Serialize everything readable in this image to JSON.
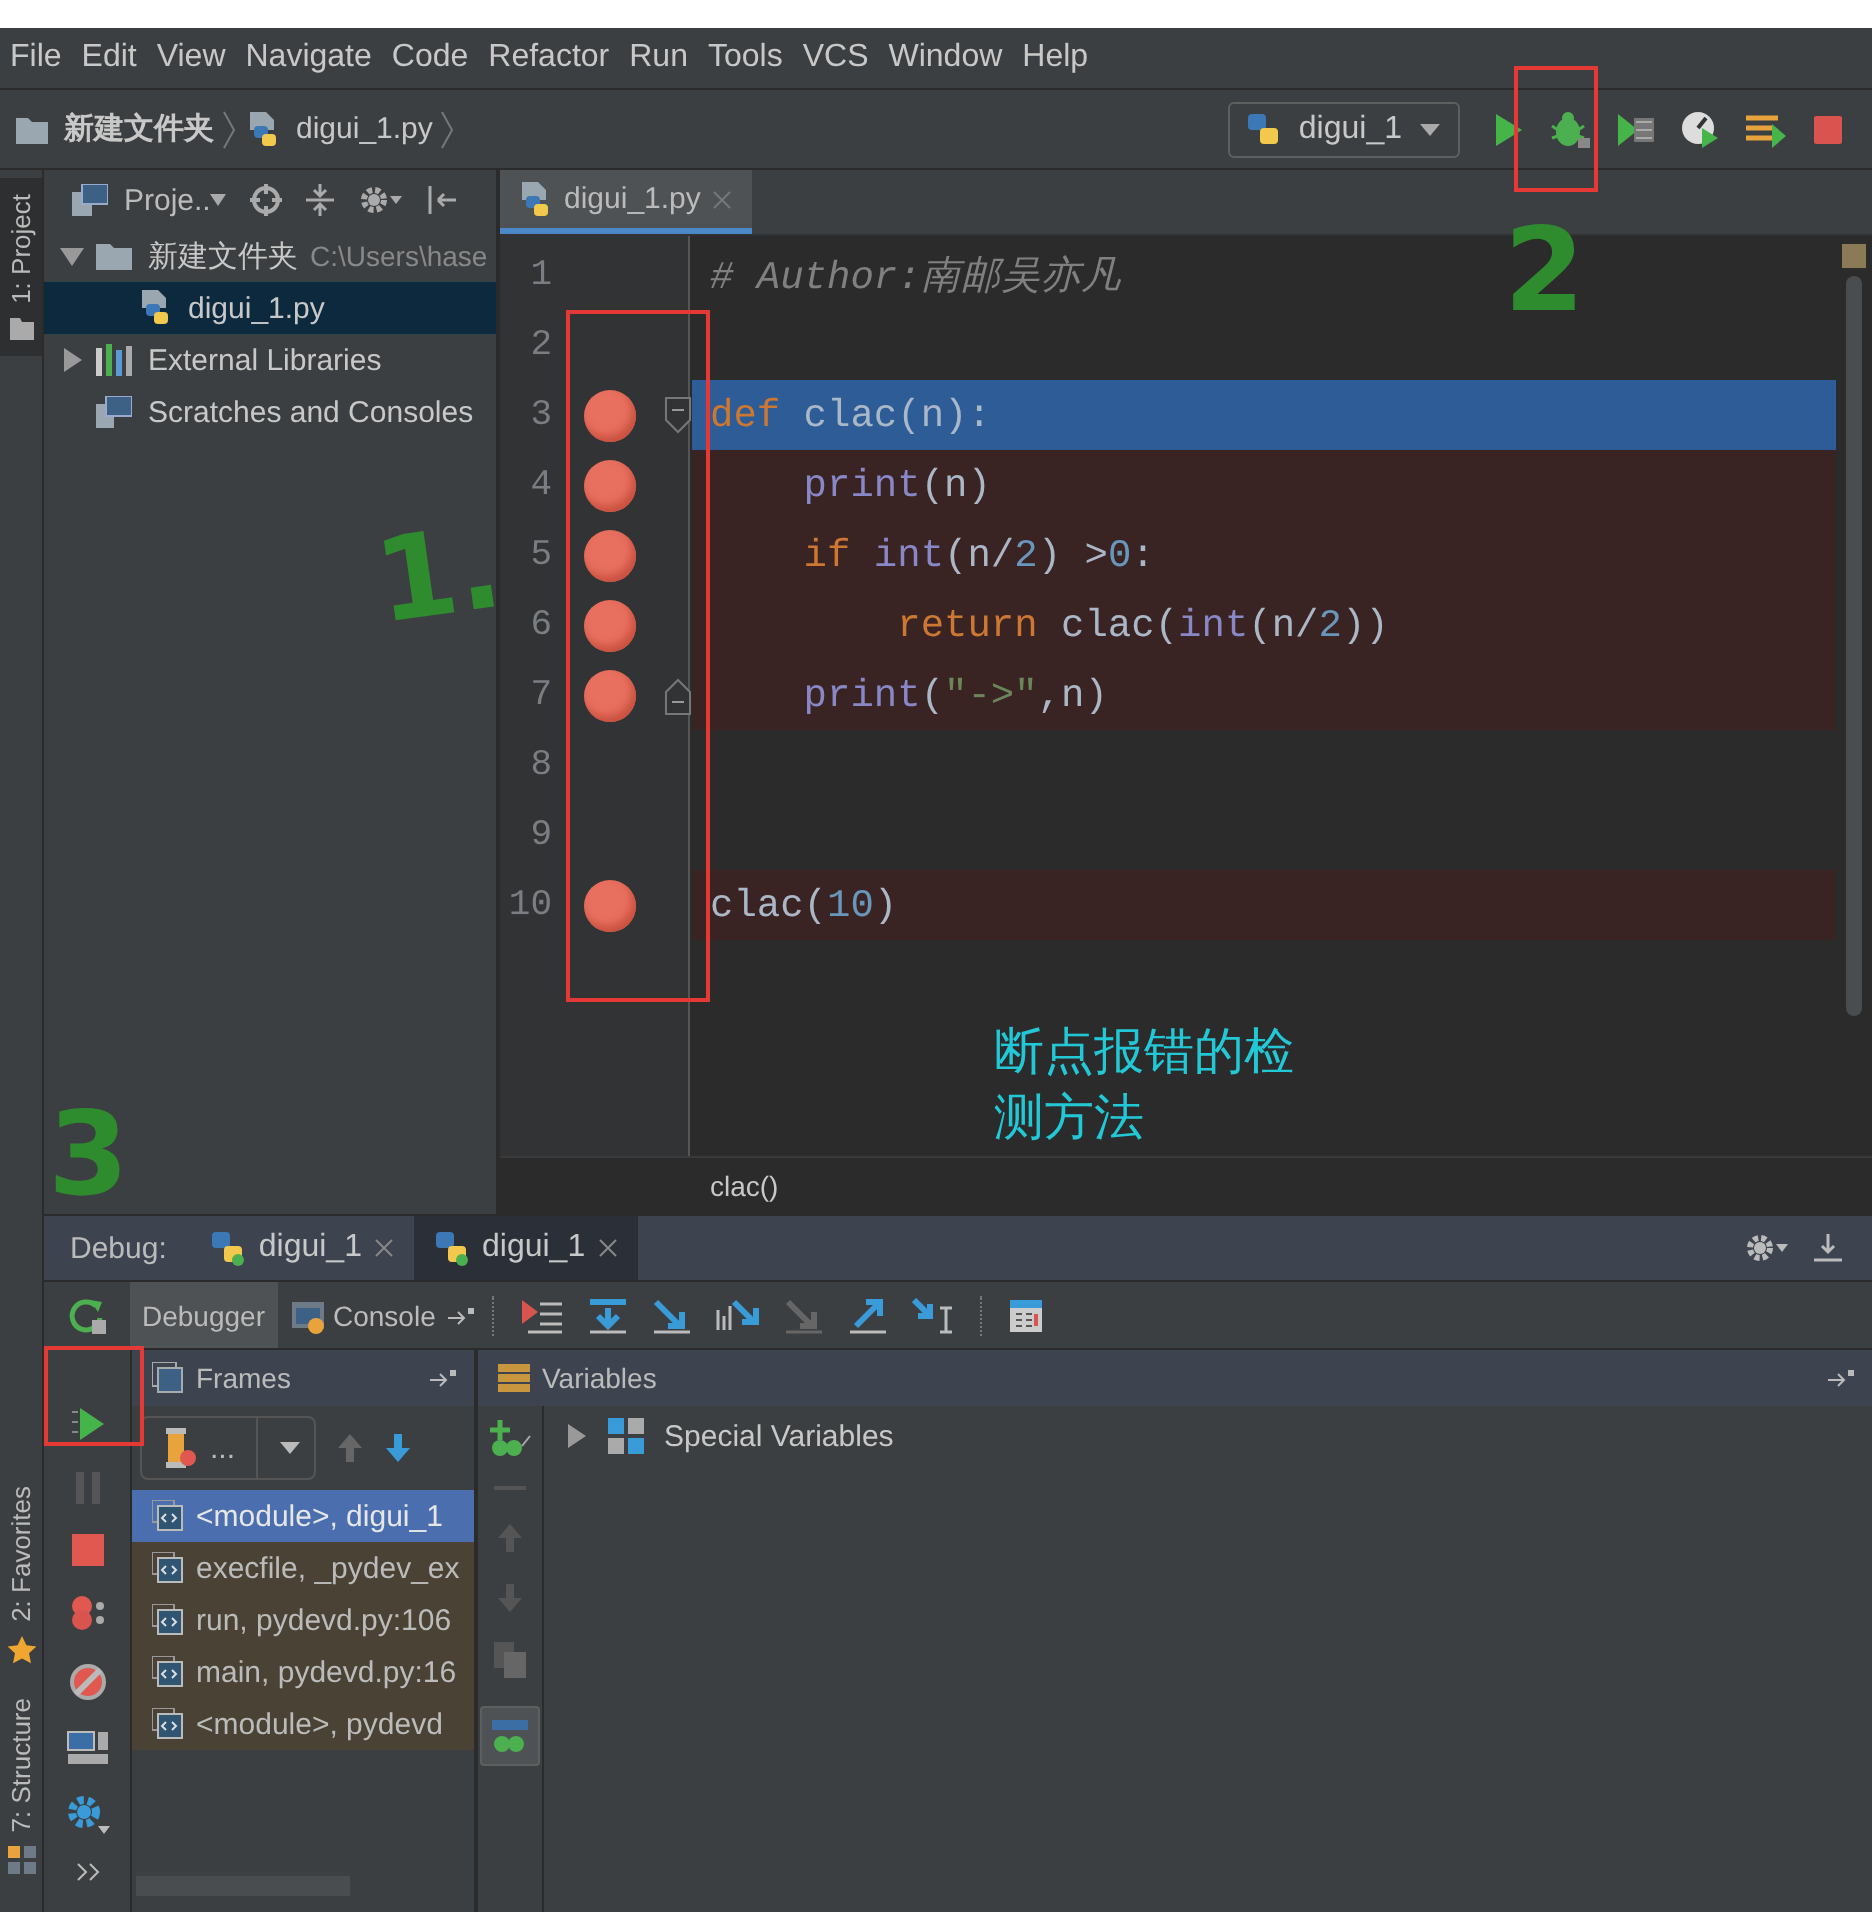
{
  "menu": [
    "File",
    "Edit",
    "View",
    "Navigate",
    "Code",
    "Refactor",
    "Run",
    "Tools",
    "VCS",
    "Window",
    "Help"
  ],
  "breadcrumb": [
    {
      "label": "新建文件夹",
      "kind": "folder"
    },
    {
      "label": "digui_1.py",
      "kind": "python"
    }
  ],
  "run_config": {
    "label": "digui_1"
  },
  "left_stripe": {
    "top": [
      {
        "label": "1: Project",
        "selected": true
      }
    ],
    "bottom": [
      {
        "label": "2: Favorites",
        "kind": "favorites",
        "selected": false
      },
      {
        "label": "7: Structure",
        "kind": "structure",
        "selected": false
      }
    ]
  },
  "project": {
    "title": "Proje..",
    "tree": [
      {
        "label": "新建文件夹",
        "path": "C:\\Users\\hase",
        "kind": "folder",
        "expanded": true,
        "selected": false,
        "children": [
          {
            "label": "digui_1.py",
            "kind": "python",
            "selected": true
          }
        ]
      },
      {
        "label": "External Libraries",
        "kind": "library",
        "expanded": false,
        "selected": false
      },
      {
        "label": "Scratches and Consoles",
        "kind": "scratch",
        "selected": false
      }
    ]
  },
  "editor": {
    "tabs": [
      {
        "label": "digui_1.py",
        "selected": true
      }
    ],
    "lines": [
      {
        "number": "1",
        "breakpoint": false,
        "current": false,
        "fold_start": false,
        "fold_end": false,
        "tokens": [
          {
            "kind": "comment",
            "text": "# Author:南邮吴亦凡"
          }
        ]
      },
      {
        "number": "2",
        "breakpoint": false,
        "current": false,
        "fold_start": false,
        "fold_end": false
      },
      {
        "number": "3",
        "breakpoint": true,
        "current": true,
        "fold_start": true,
        "fold_end": false,
        "tokens": [
          {
            "kind": "keyword",
            "text": "def"
          },
          {
            "kind": "plain",
            "text": " clac(n):"
          }
        ]
      },
      {
        "number": "4",
        "breakpoint": true,
        "current": false,
        "fold_start": false,
        "fold_end": false,
        "tokens": [
          {
            "kind": "builtin",
            "text": "    print"
          },
          {
            "kind": "plain",
            "text": "(n)"
          }
        ]
      },
      {
        "number": "5",
        "breakpoint": true,
        "current": false,
        "fold_start": false,
        "fold_end": false,
        "tokens": [
          {
            "kind": "keyword",
            "text": "    if "
          },
          {
            "kind": "builtin",
            "text": "int"
          },
          {
            "kind": "plain",
            "text": "(n/"
          },
          {
            "kind": "number",
            "text": "2"
          },
          {
            "kind": "plain",
            "text": ") >"
          },
          {
            "kind": "number",
            "text": "0"
          },
          {
            "kind": "plain",
            "text": ":"
          }
        ]
      },
      {
        "number": "6",
        "breakpoint": true,
        "current": false,
        "fold_start": false,
        "fold_end": false,
        "tokens": [
          {
            "kind": "keyword",
            "text": "        return"
          },
          {
            "kind": "plain",
            "text": " clac("
          },
          {
            "kind": "builtin",
            "text": "int"
          },
          {
            "kind": "plain",
            "text": "(n/"
          },
          {
            "kind": "number",
            "text": "2"
          },
          {
            "kind": "plain",
            "text": "))"
          }
        ]
      },
      {
        "number": "7",
        "breakpoint": true,
        "current": false,
        "fold_start": false,
        "fold_end": true,
        "tokens": [
          {
            "kind": "builtin",
            "text": "    print"
          },
          {
            "kind": "plain",
            "text": "("
          },
          {
            "kind": "string",
            "text": "\"->\""
          },
          {
            "kind": "plain",
            "text": ",n)"
          }
        ]
      },
      {
        "number": "8",
        "breakpoint": false,
        "current": false,
        "fold_start": false,
        "fold_end": false
      },
      {
        "number": "9",
        "breakpoint": false,
        "current": false,
        "fold_start": false,
        "fold_end": false
      },
      {
        "number": "10",
        "breakpoint": true,
        "current": false,
        "fold_start": false,
        "fold_end": false,
        "tokens": [
          {
            "kind": "plain",
            "text": "clac("
          },
          {
            "kind": "number",
            "text": "10"
          },
          {
            "kind": "plain",
            "text": ")"
          }
        ]
      }
    ],
    "breadcrumb": "clac()"
  },
  "debug": {
    "title": "Debug:",
    "sessions": [
      {
        "label": "digui_1",
        "selected": false
      },
      {
        "label": "digui_1",
        "selected": true
      }
    ],
    "subtabs": [
      {
        "label": "Debugger",
        "selected": true
      },
      {
        "label": "Console",
        "selected": false
      }
    ],
    "frames": {
      "title": "Frames",
      "thread": "...",
      "items": [
        {
          "label": "<module>, digui_1",
          "selected": true
        },
        {
          "label": "execfile, _pydev_ex",
          "selected": false
        },
        {
          "label": "run, pydevd.py:106",
          "selected": false
        },
        {
          "label": "main, pydevd.py:16",
          "selected": false
        },
        {
          "label": "<module>, pydevd",
          "selected": false
        }
      ]
    },
    "variables": {
      "title": "Variables",
      "items": [
        {
          "label": "Special Variables",
          "expanded": false
        }
      ]
    }
  },
  "annotations": [
    {
      "kind": "mark",
      "text": "1."
    },
    {
      "kind": "mark",
      "text": "2"
    },
    {
      "kind": "mark",
      "text": "3"
    },
    {
      "kind": "note",
      "text": "断点报错的检测方法"
    }
  ]
}
